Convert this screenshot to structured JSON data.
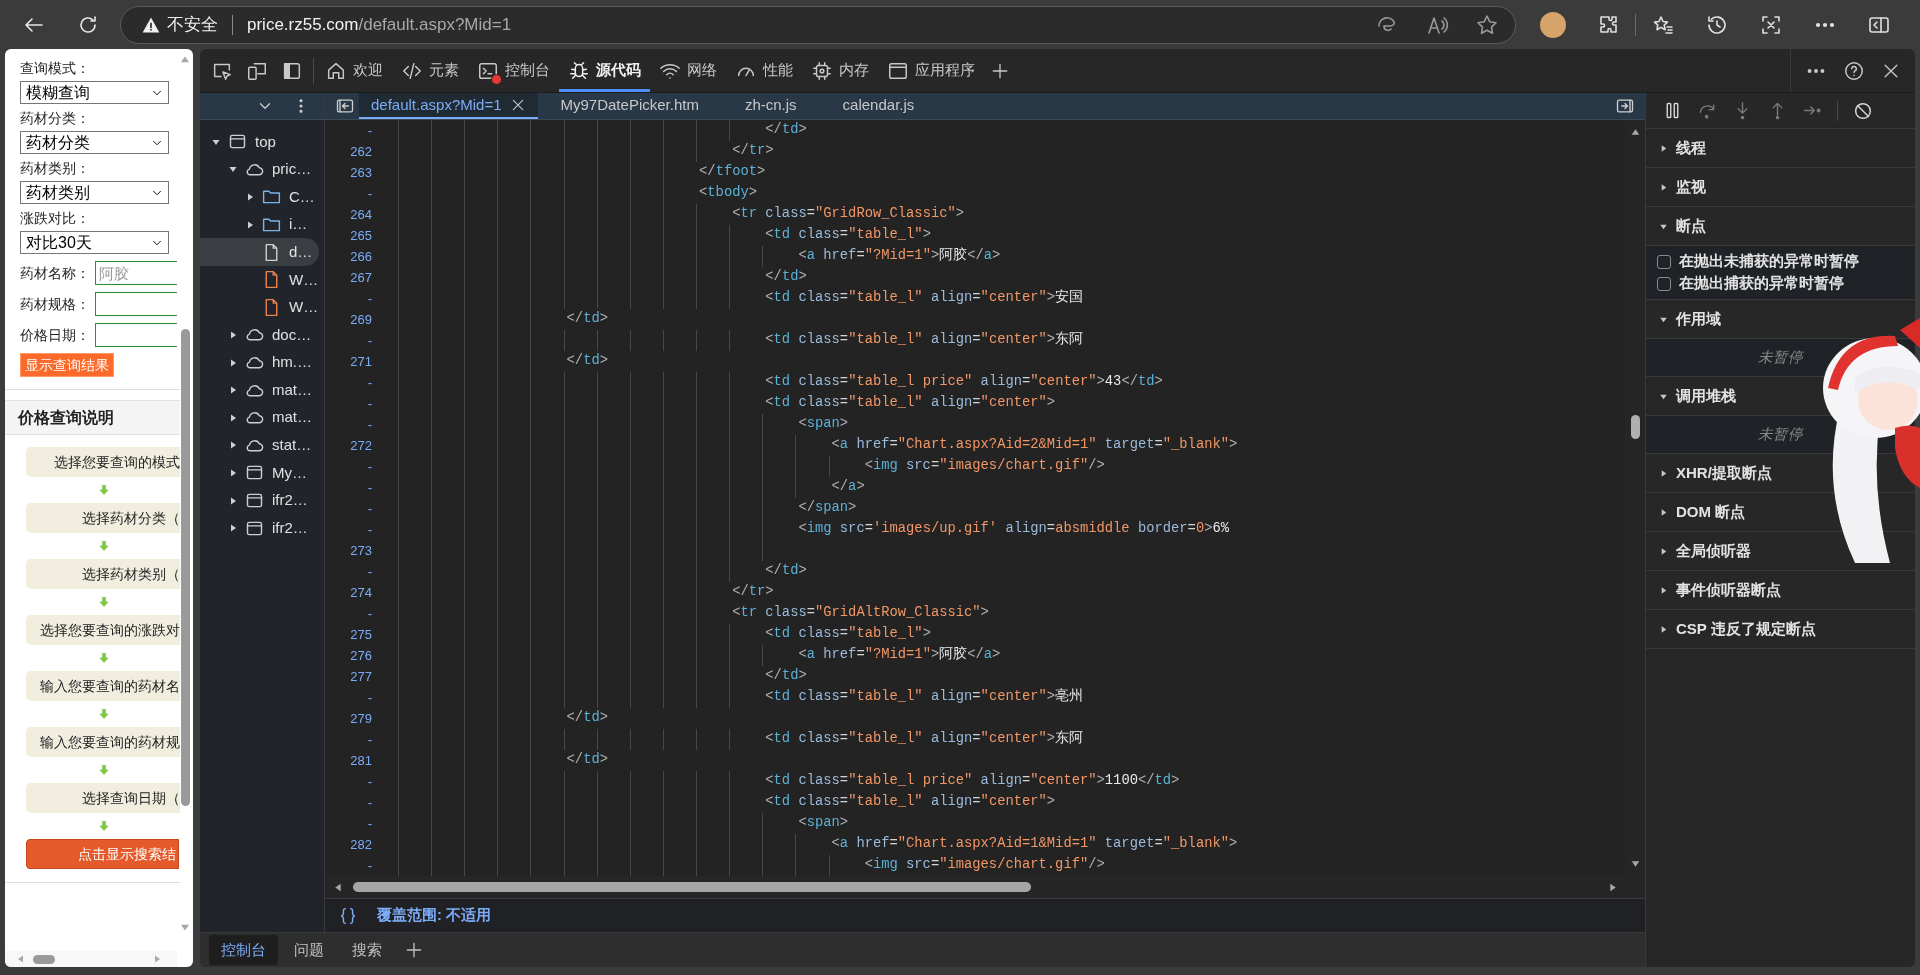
{
  "browser": {
    "security_label": "不安全",
    "url_host": "price.rz55.com",
    "url_path": "/default.aspx?Mid=1"
  },
  "page": {
    "fields": [
      {
        "kind": "select",
        "label": "查询模式：",
        "value": "模糊查询"
      },
      {
        "kind": "select",
        "label": "药材分类：",
        "value": "药材分类"
      },
      {
        "kind": "select",
        "label": "药材类别：",
        "value": "药材类别"
      },
      {
        "kind": "select",
        "label": "涨跌对比：",
        "value": "对比30天"
      },
      {
        "kind": "input",
        "label": "药材名称：",
        "placeholder": "阿胶"
      },
      {
        "kind": "input",
        "label": "药材规格："
      },
      {
        "kind": "input",
        "label": "价格日期："
      }
    ],
    "submit_button": "显示查询结果",
    "help_title": "价格查询说明",
    "steps": [
      {
        "kind": "step",
        "text": "选择您要查询的模式"
      },
      {
        "kind": "step",
        "text": "选择药材分类（"
      },
      {
        "kind": "step",
        "text": "选择药材类别（"
      },
      {
        "kind": "step",
        "text": "选择您要查询的涨跌对"
      },
      {
        "kind": "step",
        "text": "输入您要查询的药材名"
      },
      {
        "kind": "step",
        "text": "输入您要查询的药材规"
      },
      {
        "kind": "step",
        "text": "选择查询日期（"
      },
      {
        "kind": "action",
        "text": "点击显示搜索结"
      }
    ]
  },
  "devtools": {
    "main_tabs": [
      {
        "label": "欢迎",
        "selected": false,
        "error_badge": false
      },
      {
        "label": "元素",
        "selected": false,
        "error_badge": false
      },
      {
        "label": "控制台",
        "selected": false,
        "error_badge": true
      },
      {
        "label": "源代码",
        "selected": true,
        "error_badge": false
      },
      {
        "label": "网络",
        "selected": false,
        "error_badge": false
      },
      {
        "label": "性能",
        "selected": false,
        "error_badge": false
      },
      {
        "label": "内存",
        "selected": false,
        "error_badge": false
      },
      {
        "label": "应用程序",
        "selected": false,
        "error_badge": false
      }
    ],
    "navigator": [
      {
        "label": "top",
        "kind": "frame",
        "expanded": true,
        "selected": false,
        "children": [
          {
            "label": "pric…",
            "kind": "domain",
            "expanded": true,
            "selected": false,
            "children": [
              {
                "label": "C…",
                "kind": "folder",
                "expanded": false,
                "selected": false
              },
              {
                "label": "i…",
                "kind": "folder",
                "expanded": false,
                "selected": false
              },
              {
                "label": "d…",
                "kind": "document",
                "selected": true
              },
              {
                "label": "W…",
                "kind": "script",
                "selected": false
              },
              {
                "label": "W…",
                "kind": "script",
                "selected": false
              }
            ]
          },
          {
            "label": "doc…",
            "kind": "domain",
            "expanded": false,
            "selected": false
          },
          {
            "label": "hm.…",
            "kind": "domain",
            "expanded": false,
            "selected": false
          },
          {
            "label": "mat…",
            "kind": "domain",
            "expanded": false,
            "selected": false
          },
          {
            "label": "mat…",
            "kind": "domain",
            "expanded": false,
            "selected": false
          },
          {
            "label": "stat…",
            "kind": "domain",
            "expanded": false,
            "selected": false
          },
          {
            "label": "My…",
            "kind": "frame",
            "expanded": false,
            "selected": false
          },
          {
            "label": "ifr2…",
            "kind": "frame",
            "expanded": false,
            "selected": false
          },
          {
            "label": "ifr2…",
            "kind": "frame",
            "expanded": false,
            "selected": false
          }
        ]
      }
    ],
    "editor_tabs": [
      {
        "label": "default.aspx?Mid=1",
        "selected": true
      },
      {
        "label": "My97DatePicker.htm",
        "selected": false
      },
      {
        "label": "zh-cn.js",
        "selected": false
      },
      {
        "label": "calendar.js",
        "selected": false
      }
    ],
    "code_lines": [
      {
        "gutter": "-",
        "text": "                                            </td>"
      },
      {
        "gutter": "262",
        "text": "                                        </tr>"
      },
      {
        "gutter": "263",
        "text": "                                    </tfoot>"
      },
      {
        "gutter": "-",
        "text": "                                    <tbody>"
      },
      {
        "gutter": "264",
        "text": "                                        <tr class=\"GridRow_Classic\">"
      },
      {
        "gutter": "265",
        "text": "                                            <td class=\"table_l\">"
      },
      {
        "gutter": "266",
        "text": "                                                <a href=\"?Mid=1\">阿胶</a>"
      },
      {
        "gutter": "267",
        "text": "                                            </td>"
      },
      {
        "gutter": "-",
        "text": "                                            <td class=\"table_l\" align=\"center\">安国"
      },
      {
        "gutter": "269",
        "text": "                    </td>"
      },
      {
        "gutter": "-",
        "text": "                                            <td class=\"table_l\" align=\"center\">东阿"
      },
      {
        "gutter": "271",
        "text": "                    </td>"
      },
      {
        "gutter": "-",
        "text": "                                            <td class=\"table_l price\" align=\"center\">43</td>"
      },
      {
        "gutter": "-",
        "text": "                                            <td class=\"table_l\" align=\"center\">"
      },
      {
        "gutter": "-",
        "text": "                                                <span>"
      },
      {
        "gutter": "272",
        "text": "                                                    <a href=\"Chart.aspx?Aid=2&Mid=1\" target=\"_blank\">"
      },
      {
        "gutter": "-",
        "text": "                                                        <img src=\"images/chart.gif\"/>"
      },
      {
        "gutter": "-",
        "text": "                                                    </a>"
      },
      {
        "gutter": "-",
        "text": "                                                </span>"
      },
      {
        "gutter": "-",
        "text": "                                                <img src='images/up.gif' align=absmiddle border=0>6%"
      },
      {
        "gutter": "273"
      },
      {
        "gutter": "-",
        "text": "                                            </td>"
      },
      {
        "gutter": "274",
        "text": "                                        </tr>"
      },
      {
        "gutter": "-",
        "text": "                                        <tr class=\"GridAltRow_Classic\">"
      },
      {
        "gutter": "275",
        "text": "                                            <td class=\"table_l\">"
      },
      {
        "gutter": "276",
        "text": "                                                <a href=\"?Mid=1\">阿胶</a>"
      },
      {
        "gutter": "277",
        "text": "                                            </td>"
      },
      {
        "gutter": "-",
        "text": "                                            <td class=\"table_l\" align=\"center\">亳州"
      },
      {
        "gutter": "279",
        "text": "                    </td>"
      },
      {
        "gutter": "-",
        "text": "                                            <td class=\"table_l\" align=\"center\">东阿"
      },
      {
        "gutter": "281",
        "text": "                    </td>"
      },
      {
        "gutter": "-",
        "text": "                                            <td class=\"table_l price\" align=\"center\">1100</td>"
      },
      {
        "gutter": "-",
        "text": "                                            <td class=\"table_l\" align=\"center\">"
      },
      {
        "gutter": "-",
        "text": "                                                <span>"
      },
      {
        "gutter": "282",
        "text": "                                                    <a href=\"Chart.aspx?Aid=1&Mid=1\" target=\"_blank\">"
      },
      {
        "gutter": "-",
        "text": "                                                        <img src=\"images/chart.gif\"/>"
      }
    ],
    "coverage": "覆盖范围: 不适用",
    "drawer_tabs": [
      {
        "label": "控制台",
        "selected": true
      },
      {
        "label": "问题",
        "selected": false
      },
      {
        "label": "搜索",
        "selected": false
      }
    ],
    "debugger_sections": [
      {
        "title": "线程",
        "expanded": false
      },
      {
        "title": "监视",
        "expanded": false
      },
      {
        "title": "断点",
        "expanded": true,
        "checkboxes": [
          {
            "label": "在抛出未捕获的异常时暂停",
            "checked": false
          },
          {
            "label": "在抛出捕获的异常时暂停",
            "checked": false
          }
        ]
      },
      {
        "title": "作用域",
        "expanded": true,
        "message": "未暂停"
      },
      {
        "title": "调用堆栈",
        "expanded": true,
        "message": "未暂停"
      },
      {
        "title": "XHR/提取断点",
        "expanded": false
      },
      {
        "title": "DOM 断点",
        "expanded": false
      },
      {
        "title": "全局侦听器",
        "expanded": false
      },
      {
        "title": "事件侦听器断点",
        "expanded": false
      },
      {
        "title": "CSP 违反了规定断点",
        "expanded": false
      }
    ]
  }
}
